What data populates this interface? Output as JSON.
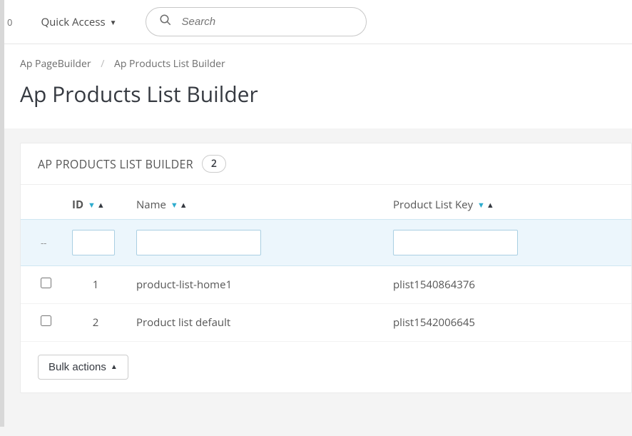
{
  "topbar": {
    "left_num": "0",
    "quick_access": "Quick Access",
    "search_placeholder": "Search"
  },
  "breadcrumb": {
    "parent": "Ap PageBuilder",
    "current": "Ap Products List Builder"
  },
  "page_title": "Ap Products List Builder",
  "panel": {
    "title": "AP PRODUCTS LIST BUILDER",
    "count": "2"
  },
  "columns": {
    "id": "ID",
    "name": "Name",
    "key": "Product List Key"
  },
  "filter_row": {
    "dash": "--"
  },
  "rows": [
    {
      "id": "1",
      "name": "product-list-home1",
      "key": "plist1540864376"
    },
    {
      "id": "2",
      "name": "Product list default",
      "key": "plist1542006645"
    }
  ],
  "bulk": {
    "label": "Bulk actions"
  }
}
